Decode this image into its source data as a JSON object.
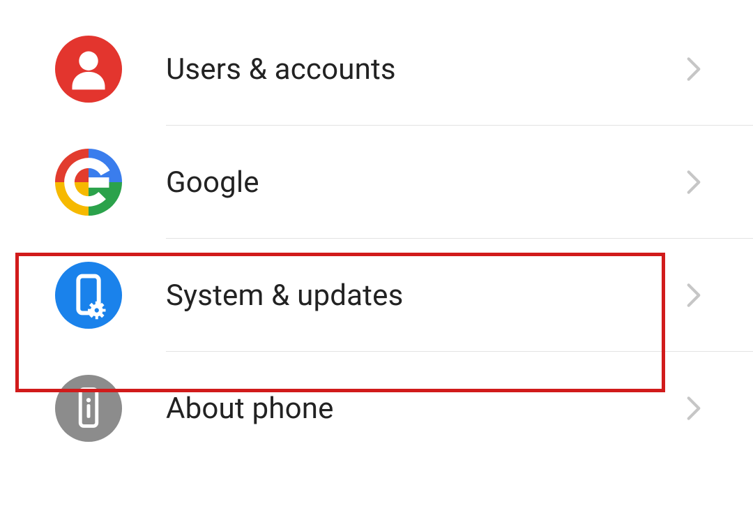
{
  "colors": {
    "accent_red": "#e3352e",
    "accent_blue": "#1a82eb",
    "accent_grey": "#8c8c8c",
    "google_red": "#e23c2e",
    "google_yellow": "#f6b900",
    "google_green": "#2ba24b",
    "google_blue": "#3a7ded",
    "highlight_border": "#d11b1b",
    "chevron": "#c6c6c6"
  },
  "settings": {
    "items": [
      {
        "label": "Users & accounts",
        "icon_name": "user-accounts-icon"
      },
      {
        "label": "Google",
        "icon_name": "google-icon"
      },
      {
        "label": "System & updates",
        "icon_name": "system-updates-icon"
      },
      {
        "label": "About phone",
        "icon_name": "about-phone-icon"
      }
    ],
    "highlighted_index": 2
  }
}
